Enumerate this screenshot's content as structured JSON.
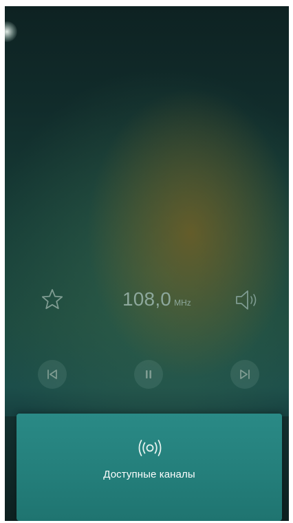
{
  "player": {
    "frequency_value": "108,0",
    "frequency_unit": "MHz"
  },
  "icons": {
    "favorite": "star-outline-icon",
    "volume": "speaker-icon",
    "previous": "skip-previous-icon",
    "pause": "pause-icon",
    "next": "skip-next-icon",
    "channels": "radio-broadcast-icon"
  },
  "channels_panel": {
    "label": "Доступные каналы"
  },
  "colors": {
    "accent": "#2a8a86",
    "frequency_text": "#8da89c",
    "icon": "#7f9c92"
  }
}
